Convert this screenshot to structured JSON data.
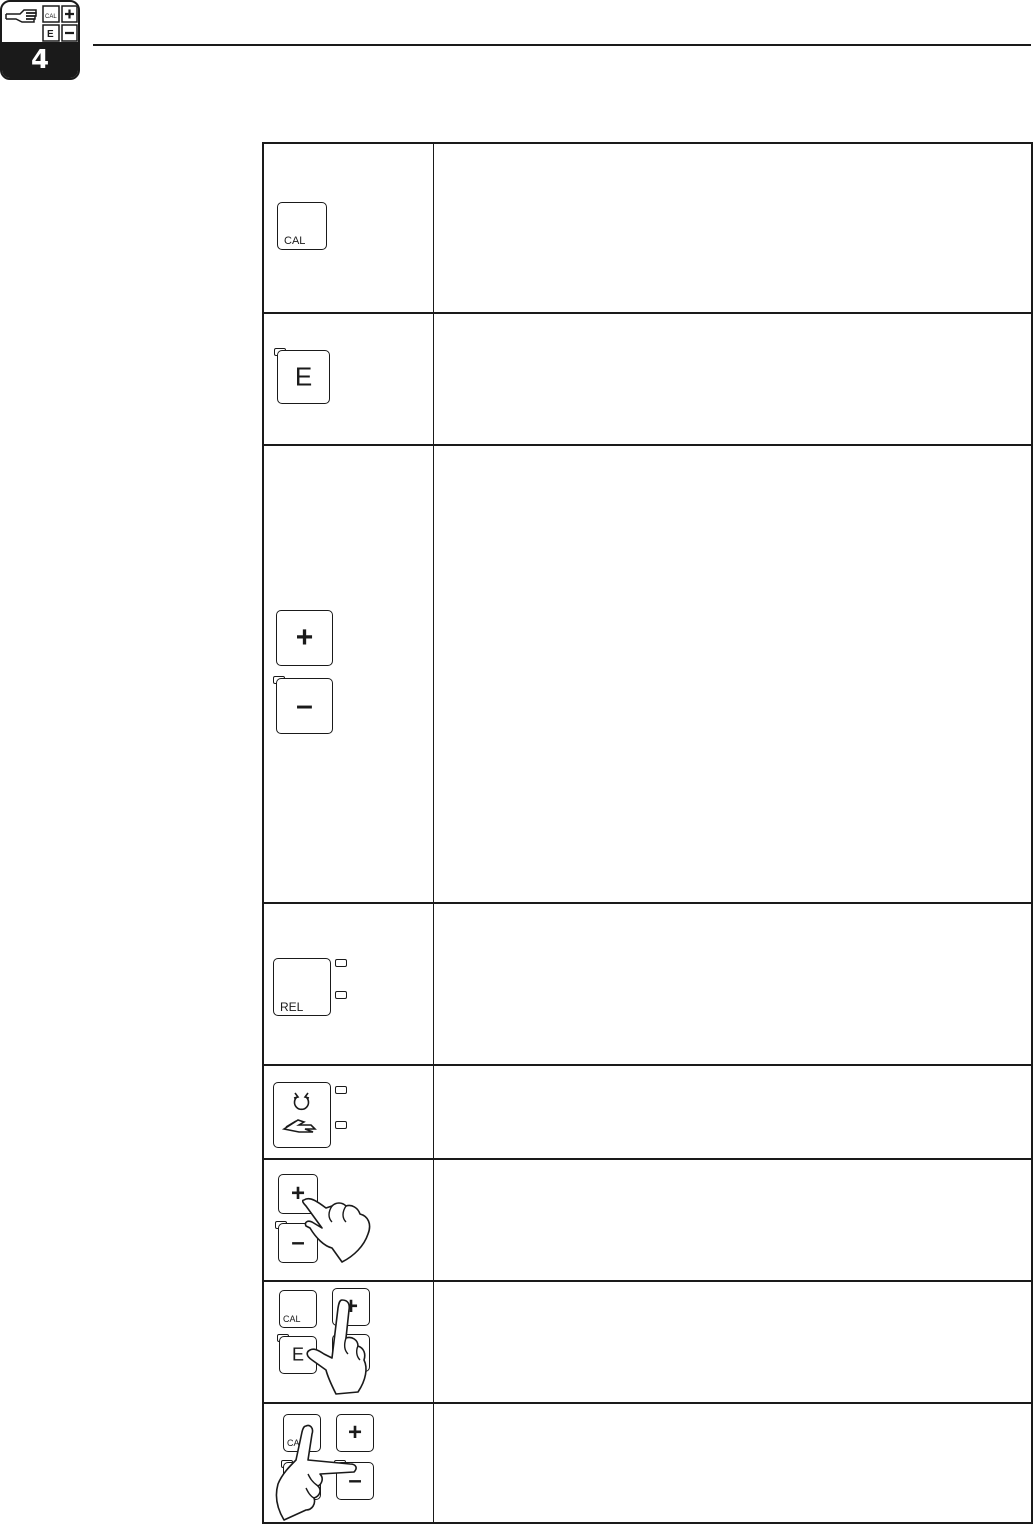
{
  "header": {
    "chapter_number": "4",
    "tab_icons": [
      "pointing-hand-icon",
      "cal-key-icon",
      "plus-key-icon",
      "e-key-icon",
      "minus-key-icon"
    ]
  },
  "keys": [
    {
      "id": "cal",
      "label": "CAL"
    },
    {
      "id": "e",
      "label": "E"
    },
    {
      "id": "plus-minus",
      "plus": "+",
      "minus": "–"
    },
    {
      "id": "rel",
      "label": "REL"
    },
    {
      "id": "auto-manual",
      "icons": [
        "auto-mode-icon",
        "manual-hand-icon"
      ]
    },
    {
      "id": "plus-minus-press",
      "plus": "+",
      "minus": "–"
    },
    {
      "id": "cal-e-plus-press",
      "cal": "CAL",
      "e": "E",
      "plus": "+"
    },
    {
      "id": "cal-minus-press",
      "cal": "CAL",
      "plus": "+",
      "minus": "–"
    }
  ]
}
